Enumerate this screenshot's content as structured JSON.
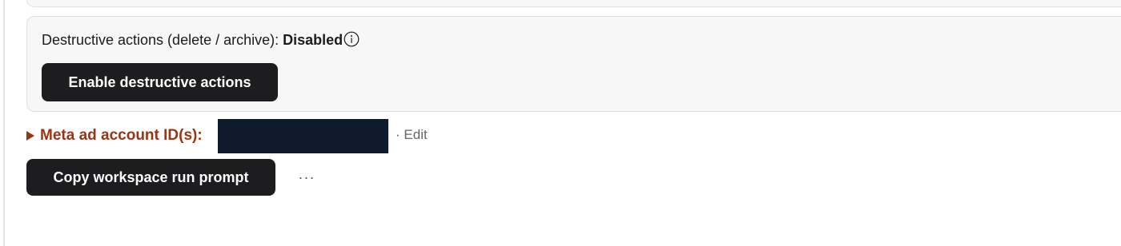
{
  "destructive": {
    "label": "Destructive actions (delete / archive):",
    "status": "Disabled",
    "info_icon": "info-circle-icon",
    "enable_button": "Enable destructive actions"
  },
  "ad_account": {
    "toggle_icon": "disclosure-triangle-icon",
    "label": "Meta ad account ID(s):",
    "separator": "·",
    "edit_label": "Edit"
  },
  "actions": {
    "copy_button": "Copy workspace run prompt",
    "more_label": "···",
    "more_icon": "more-horizontal-icon"
  },
  "colors": {
    "accent": "#9a3412",
    "button_bg": "#1d1d1f",
    "card_bg": "#f7f7f7",
    "muted_text": "#66666b",
    "redaction": "#0f1b2d"
  }
}
